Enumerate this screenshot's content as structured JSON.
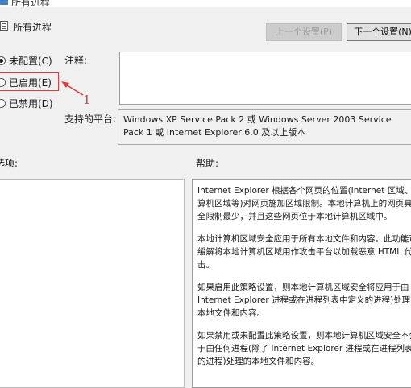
{
  "window": {
    "title": "所有进程"
  },
  "header": {
    "title": "所有进程",
    "prev_button": "上一个设置(P)",
    "next_button": "下一个设置(N)"
  },
  "options": [
    {
      "label": "未配置(C)",
      "checked": true
    },
    {
      "label": "已启用(E)",
      "checked": false
    },
    {
      "label": "已禁用(D)",
      "checked": false
    }
  ],
  "labels": {
    "comment": "注释:",
    "platform": "支持的平台:",
    "options_section": "选项:",
    "help_section": "帮助:"
  },
  "platform_text": "Windows XP Service Pack 2 或 Windows Server 2003 Service Pack 1 或 Internet Explorer 6.0 及以上版本",
  "annotation": {
    "number": "1",
    "color": "#e23a3a"
  },
  "help_paragraphs": [
    "Internet Explorer 根据各个网页的位置(Internet 区域、本地计算机区域等)对网页施加区域限制。本地计算机上的网页具有的安全限制最少，并且这些网页位于本地计算机区域中。",
    "本地计算机区域安全应用于所有本地文件和内容。此功能可帮助缓解将本地计算机区域用作攻击平台以加载恶意 HTML 代码的攻击。",
    "如果启用此策略设置，则本地计算机区域安全将应用于由 Internet Explorer 进程或在进程列表中定义的进程)处理的所有本地文件和内容。",
    "如果禁用或未配置此策略设置，则本地计算机区域安全不会应用于由任何进程(除了 Internet Explorer 进程或在进程列表中定义的进程)处理的本地文件和内容。"
  ]
}
